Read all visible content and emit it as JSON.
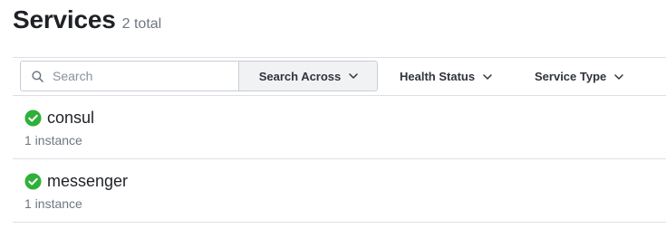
{
  "header": {
    "title": "Services",
    "count": "2 total"
  },
  "toolbar": {
    "search_placeholder": "Search",
    "search_value": "",
    "search_across_label": "Search Across",
    "health_status_label": "Health Status",
    "service_type_label": "Service Type"
  },
  "icons": {
    "search": "search-icon",
    "chevron": "chevron-down-icon",
    "status": "check-circle-icon"
  },
  "colors": {
    "status_passing": "#2eb039"
  },
  "services": [
    {
      "name": "consul",
      "instances": "1 instance",
      "status": "passing"
    },
    {
      "name": "messenger",
      "instances": "1 instance",
      "status": "passing"
    }
  ]
}
